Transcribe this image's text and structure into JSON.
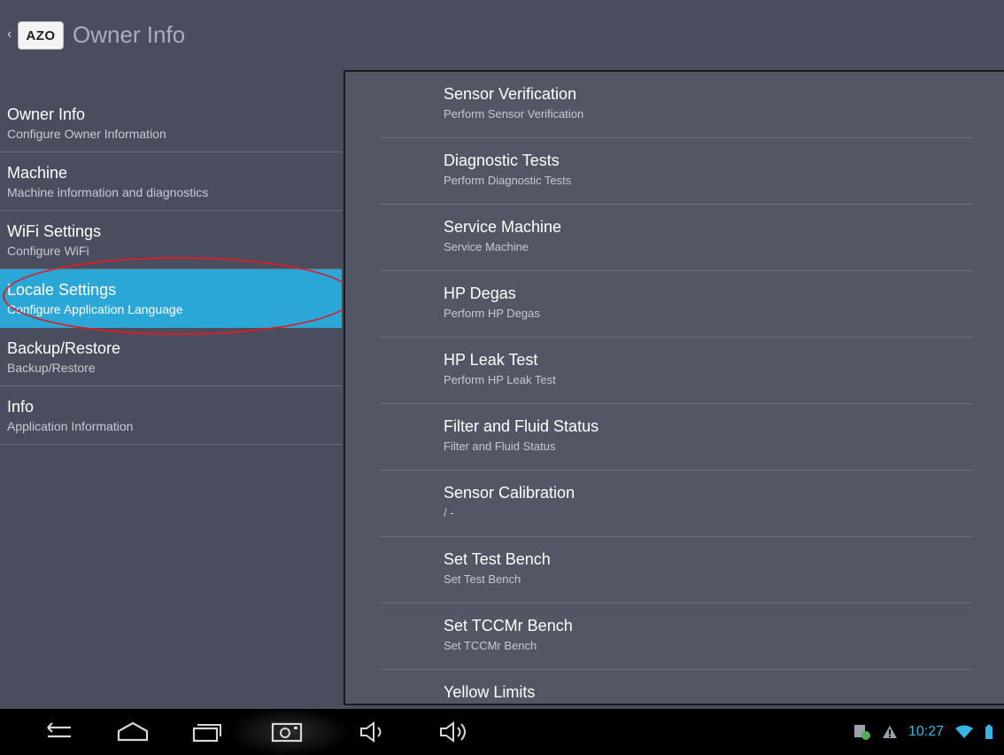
{
  "action_bar": {
    "logo_text": "AZO",
    "title": "Owner Info"
  },
  "headers": [
    {
      "title": "Owner Info",
      "summary": "Configure Owner Information"
    },
    {
      "title": "Machine",
      "summary": "Machine information and diagnostics"
    },
    {
      "title": "WiFi Settings",
      "summary": "Configure WiFi"
    },
    {
      "title": "Locale Settings",
      "summary": "Configure Application Language"
    },
    {
      "title": "Backup/Restore",
      "summary": "Backup/Restore"
    },
    {
      "title": "Info",
      "summary": "Application Information"
    }
  ],
  "preferences": [
    {
      "title": "Sensor Verification",
      "summary": "Perform Sensor Verification"
    },
    {
      "title": "Diagnostic Tests",
      "summary": "Perform Diagnostic Tests"
    },
    {
      "title": "Service Machine",
      "summary": "Service Machine"
    },
    {
      "title": "HP Degas",
      "summary": "Perform HP Degas"
    },
    {
      "title": "HP Leak Test",
      "summary": "Perform HP Leak Test"
    },
    {
      "title": "Filter and Fluid Status",
      "summary": "Filter and Fluid Status"
    },
    {
      "title": "Sensor Calibration",
      "summary": "/ -"
    },
    {
      "title": "Set Test Bench",
      "summary": "Set Test Bench"
    },
    {
      "title": "Set TCCMr Bench",
      "summary": "Set TCCMr Bench"
    },
    {
      "title": "Yellow Limits",
      "summary": ""
    }
  ],
  "status_bar": {
    "time": "10:27"
  },
  "icons": {
    "back": "back-icon",
    "home": "home-icon",
    "recent_apps": "recent-apps-icon",
    "screenshot": "screenshot-icon",
    "volume_down": "volume-down-icon",
    "volume_up": "volume-up-icon",
    "notification": "notification-icon",
    "warning": "warning-icon",
    "wifi": "wifi-icon",
    "battery": "battery-icon"
  },
  "colors": {
    "background": "#4a4d5e",
    "detail_pane": "#535665",
    "selected": "#2aa6d7",
    "annotation": "#d42027",
    "clock": "#33b5e5"
  }
}
